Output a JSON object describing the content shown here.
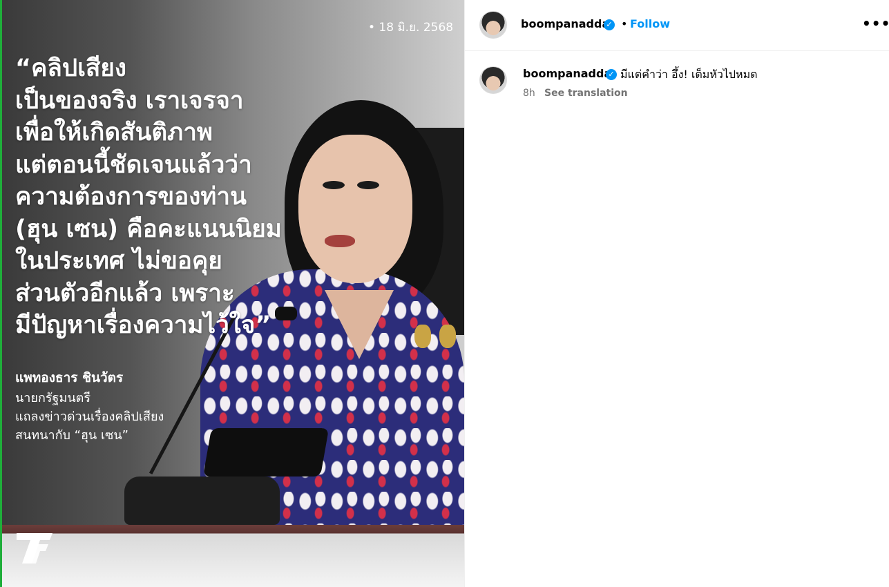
{
  "post_image": {
    "date": "• 18 มิ.ย. 2568",
    "quote_lines": [
      "“คลิปเสียง",
      "เป็นของจริง เราเจรจา",
      "เพื่อให้เกิดสันติภาพ",
      "แต่ตอนนี้ชัดเจนแล้วว่า",
      "ความต้องการของท่าน",
      "(ฮุน เซน) คือคะแนนนิยม",
      "ในประเทศ ไม่ขอคุย",
      "ส่วนตัวอีกแล้ว เพราะ",
      "มีปัญหาเรื่องความไว้ใจ”"
    ],
    "author_name": "แพทองธาร ชินวัตร",
    "author_info_lines": [
      "นายกรัฐมนตรี",
      "แถลงข่าวด่วนเรื่องคลิปเสียง",
      "สนทนากับ “ฮุน เซน”"
    ],
    "logo_icon": "thairath-logo"
  },
  "header": {
    "username": "boompanadda",
    "verified_icon": "verified-badge-icon",
    "separator": "•",
    "follow_label": "Follow",
    "more_label": "•••"
  },
  "caption": {
    "username": "boompanadda",
    "text": "มีแต่คำว่า อึ้ง! เต็มหัวไปหมด",
    "time": "8h",
    "see_translation": "See translation"
  },
  "colors": {
    "accent": "#0095f6",
    "secondary_text": "#737373",
    "brand_edge": "#1fae3a"
  }
}
